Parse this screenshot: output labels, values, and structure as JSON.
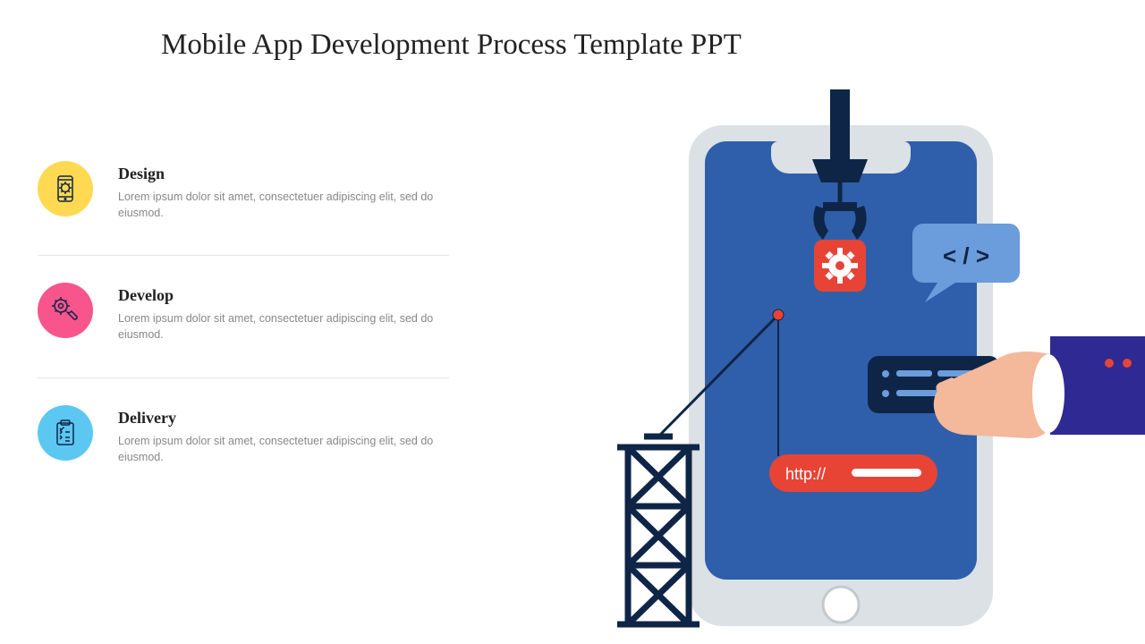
{
  "title": "Mobile App Development Process Template PPT",
  "items": [
    {
      "title": "Design",
      "desc": "Lorem ipsum dolor sit amet, consectetuer adipiscing elit, sed do eiusmod.",
      "iconColor": "#ffd952",
      "iconName": "mobile-gear-icon"
    },
    {
      "title": "Develop",
      "desc": "Lorem ipsum dolor sit amet, consectetuer adipiscing elit, sed do eiusmod.",
      "iconColor": "#f7558c",
      "iconName": "wrench-gear-icon"
    },
    {
      "title": "Delivery",
      "desc": "Lorem ipsum dolor sit amet, consectetuer adipiscing elit, sed do eiusmod.",
      "iconColor": "#5cc8f2",
      "iconName": "clipboard-check-icon"
    }
  ],
  "illustration": {
    "urlLabel": "http://",
    "codeLabel": "< / >"
  }
}
